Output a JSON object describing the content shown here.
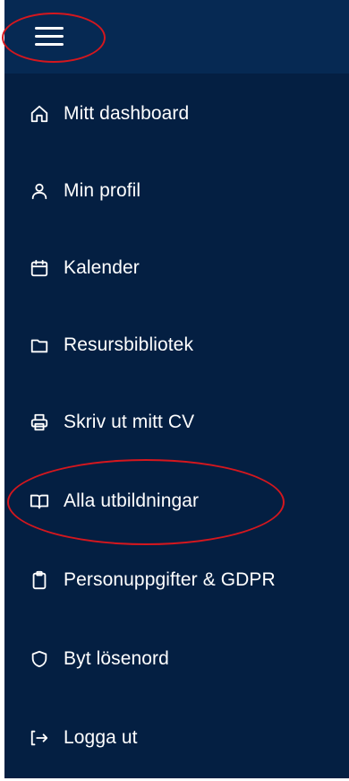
{
  "menu": {
    "toggle_icon": "hamburger-menu-icon",
    "items": [
      {
        "label": "Mitt dashboard",
        "icon": "home-icon"
      },
      {
        "label": "Min profil",
        "icon": "user-icon"
      },
      {
        "label": "Kalender",
        "icon": "calendar-icon"
      },
      {
        "label": "Resursbibliotek",
        "icon": "folder-icon"
      },
      {
        "label": "Skriv ut mitt CV",
        "icon": "printer-icon"
      },
      {
        "label": "Alla utbildningar",
        "icon": "book-open-icon"
      },
      {
        "label": "Personuppgifter & GDPR",
        "icon": "clipboard-icon"
      },
      {
        "label": "Byt lösenord",
        "icon": "shield-icon"
      },
      {
        "label": "Logga ut",
        "icon": "logout-icon"
      }
    ]
  },
  "colors": {
    "panel_background": "#041f42",
    "topbar_background": "#062953",
    "text": "#ffffff",
    "highlight_circle": "#d4171e"
  }
}
